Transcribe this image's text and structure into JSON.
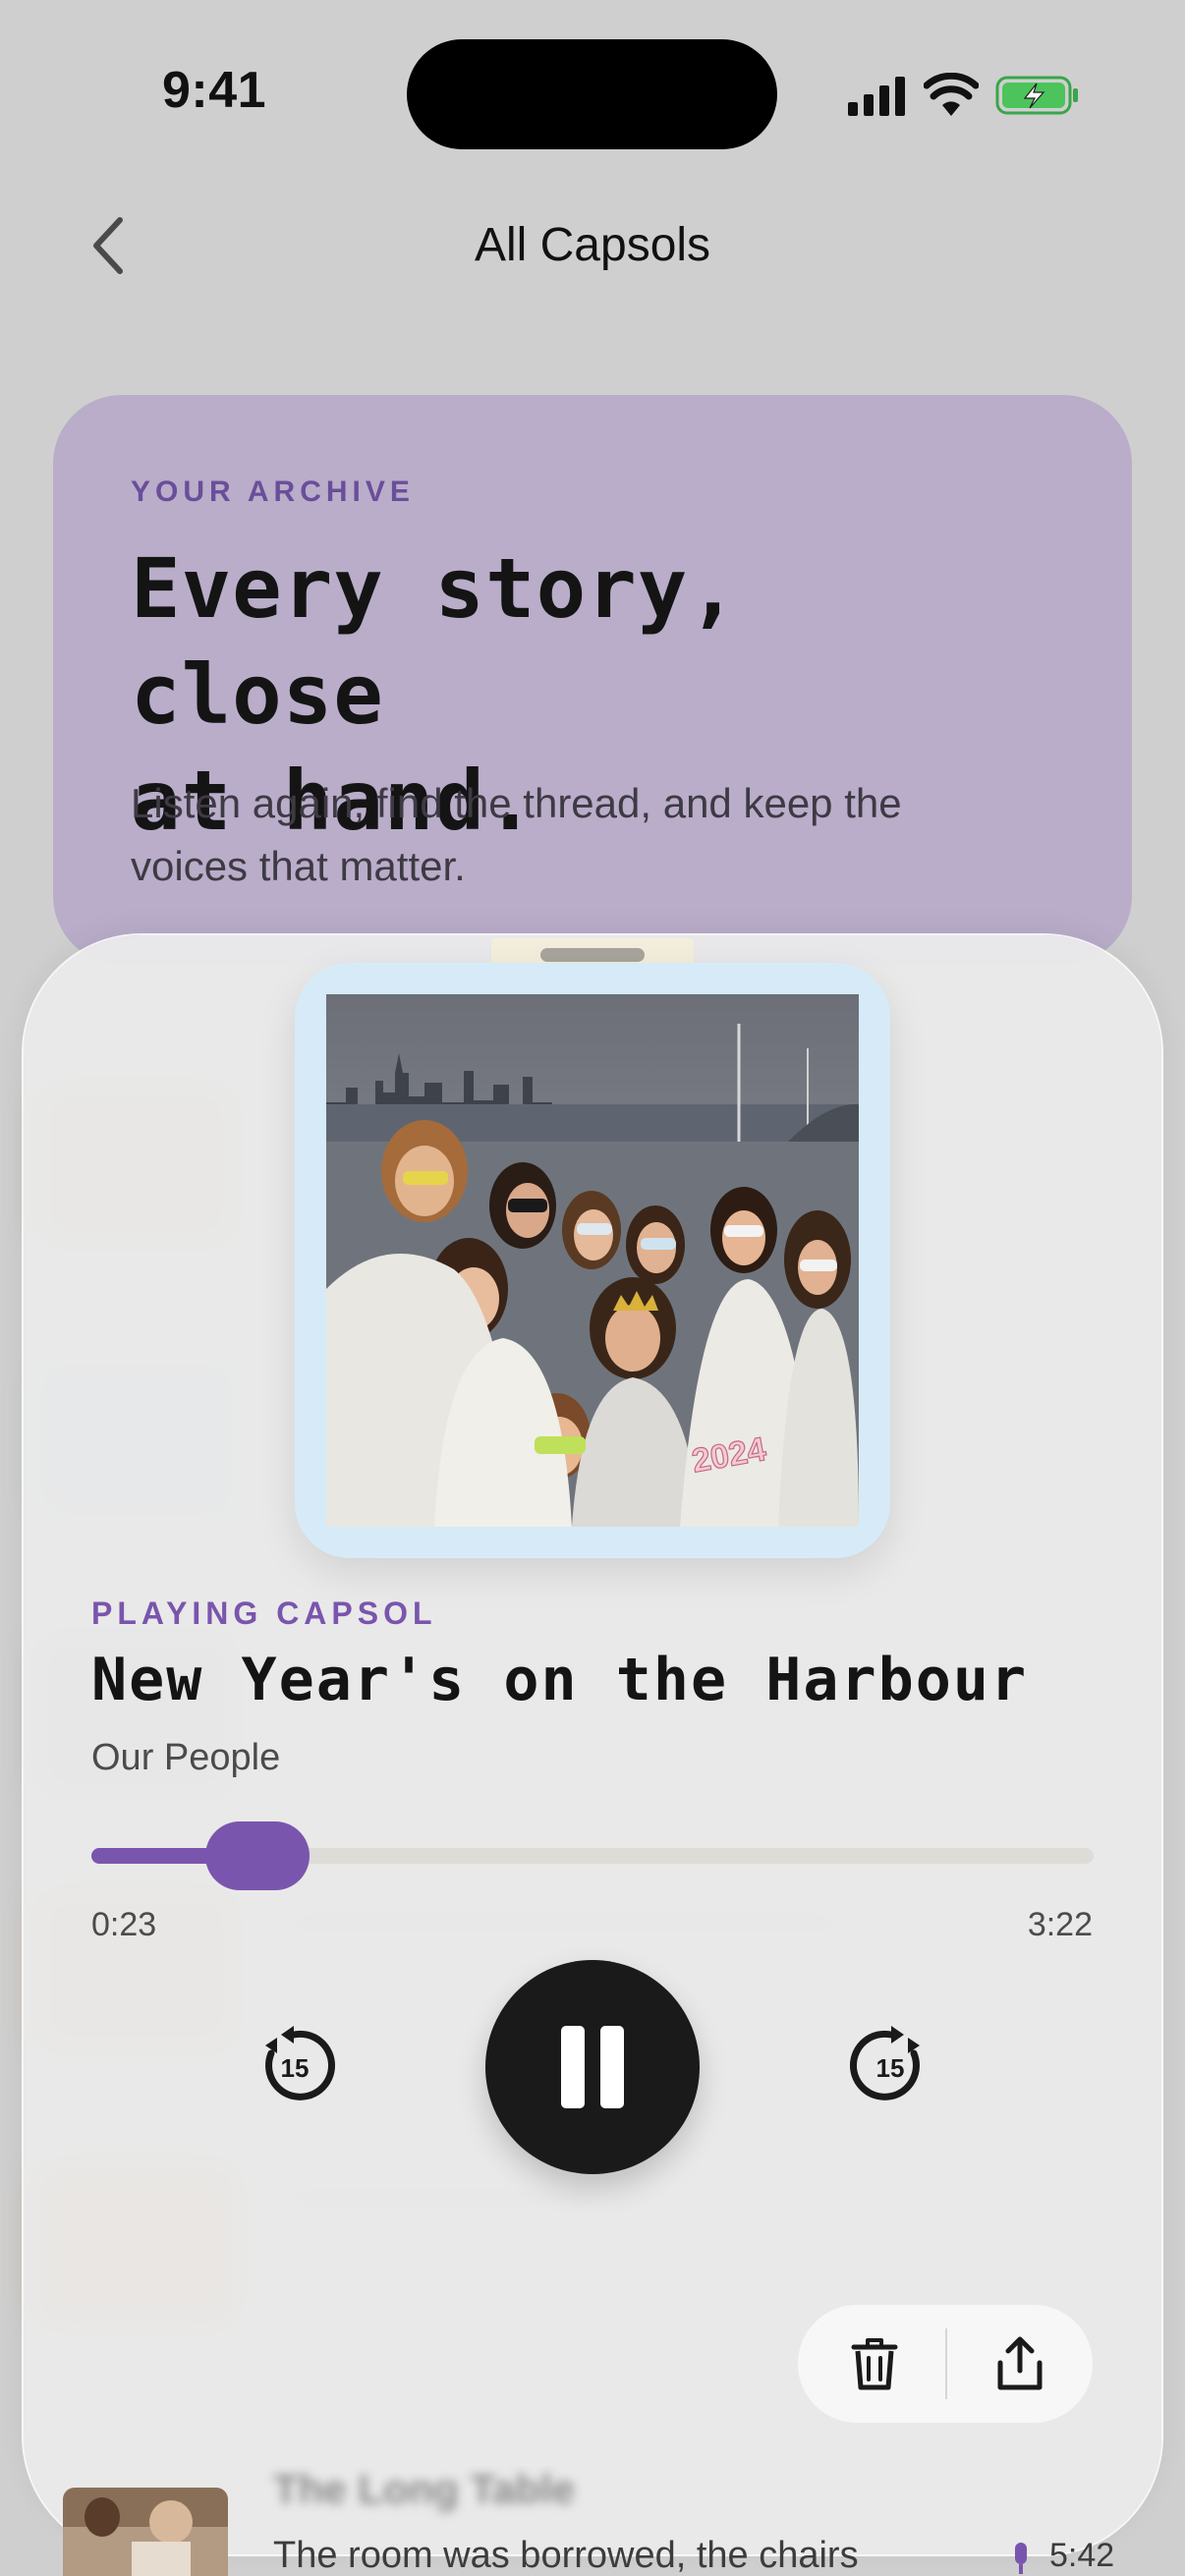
{
  "status_bar": {
    "time": "9:41",
    "icons": [
      "signal-icon",
      "wifi-icon",
      "battery-charging-icon"
    ]
  },
  "nav": {
    "back_icon": "chevron-left-icon",
    "title": "All Capsols"
  },
  "archive": {
    "eyebrow": "YOUR ARCHIVE",
    "headline_line1": "Every story, close",
    "headline_line2": "at hand.",
    "body_line1": "Listen again, find the thread, and keep the",
    "body_line2": "voices that matter."
  },
  "player": {
    "eyebrow": "PLAYING CAPSOL",
    "title": "New Year's on the Harbour",
    "subtitle": "Our People",
    "elapsed": "0:23",
    "total": "3:22",
    "progress": 0.114,
    "rewind_label": "15",
    "forward_label": "15",
    "photo_caption_mark": "2024",
    "icons": [
      "rewind-15-icon",
      "pause-icon",
      "forward-15-icon",
      "trash-icon",
      "share-icon"
    ]
  },
  "peek_item": {
    "title": "The Long Table",
    "snippet": "The room was borrowed, the chairs",
    "duration": "5:42"
  },
  "colors": {
    "accent": "#7a55ad",
    "archive_card": "#b9adc9",
    "polaroid_frame": "#d6ebf7"
  }
}
